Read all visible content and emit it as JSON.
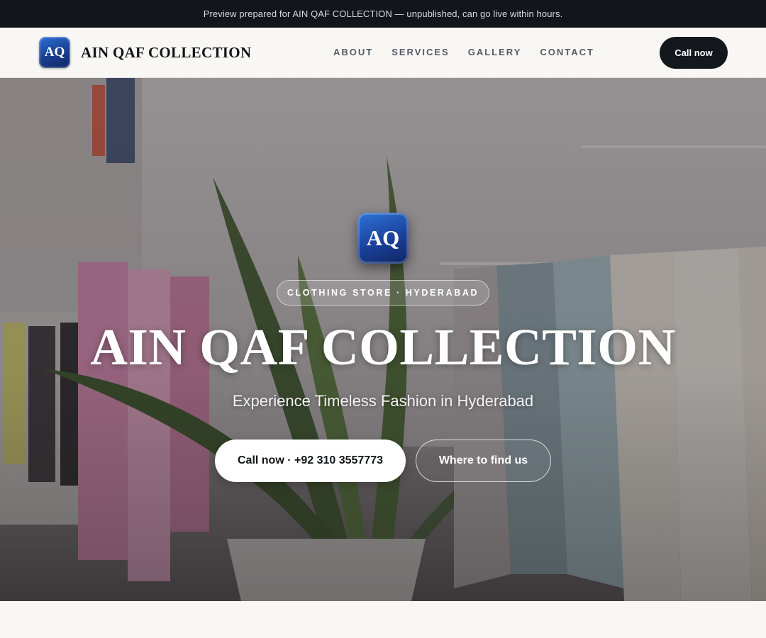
{
  "banner": {
    "text": "Preview prepared for AIN QAF COLLECTION — unpublished, can go live within hours."
  },
  "header": {
    "logo_text": "AQ",
    "brand_name": "AIN QAF COLLECTION",
    "nav": [
      {
        "label": "ABOUT"
      },
      {
        "label": "SERVICES"
      },
      {
        "label": "GALLERY"
      },
      {
        "label": "CONTACT"
      }
    ],
    "cta_label": "Call now"
  },
  "hero": {
    "logo_text": "AQ",
    "eyebrow": "CLOTHING STORE · HYDERABAD",
    "title": "AIN QAF COLLECTION",
    "subtitle": "Experience Timeless Fashion in Hyderabad",
    "primary_button": "Call now · +92 310 3557773",
    "secondary_button": "Where to find us",
    "background_image": "clothing-store-interior-with-plant-photo"
  },
  "colors": {
    "banner_bg": "#12151c",
    "page_bg": "#f8f7f4",
    "cta_dark": "#14171d",
    "logo_blue": "#1a3f8f"
  }
}
